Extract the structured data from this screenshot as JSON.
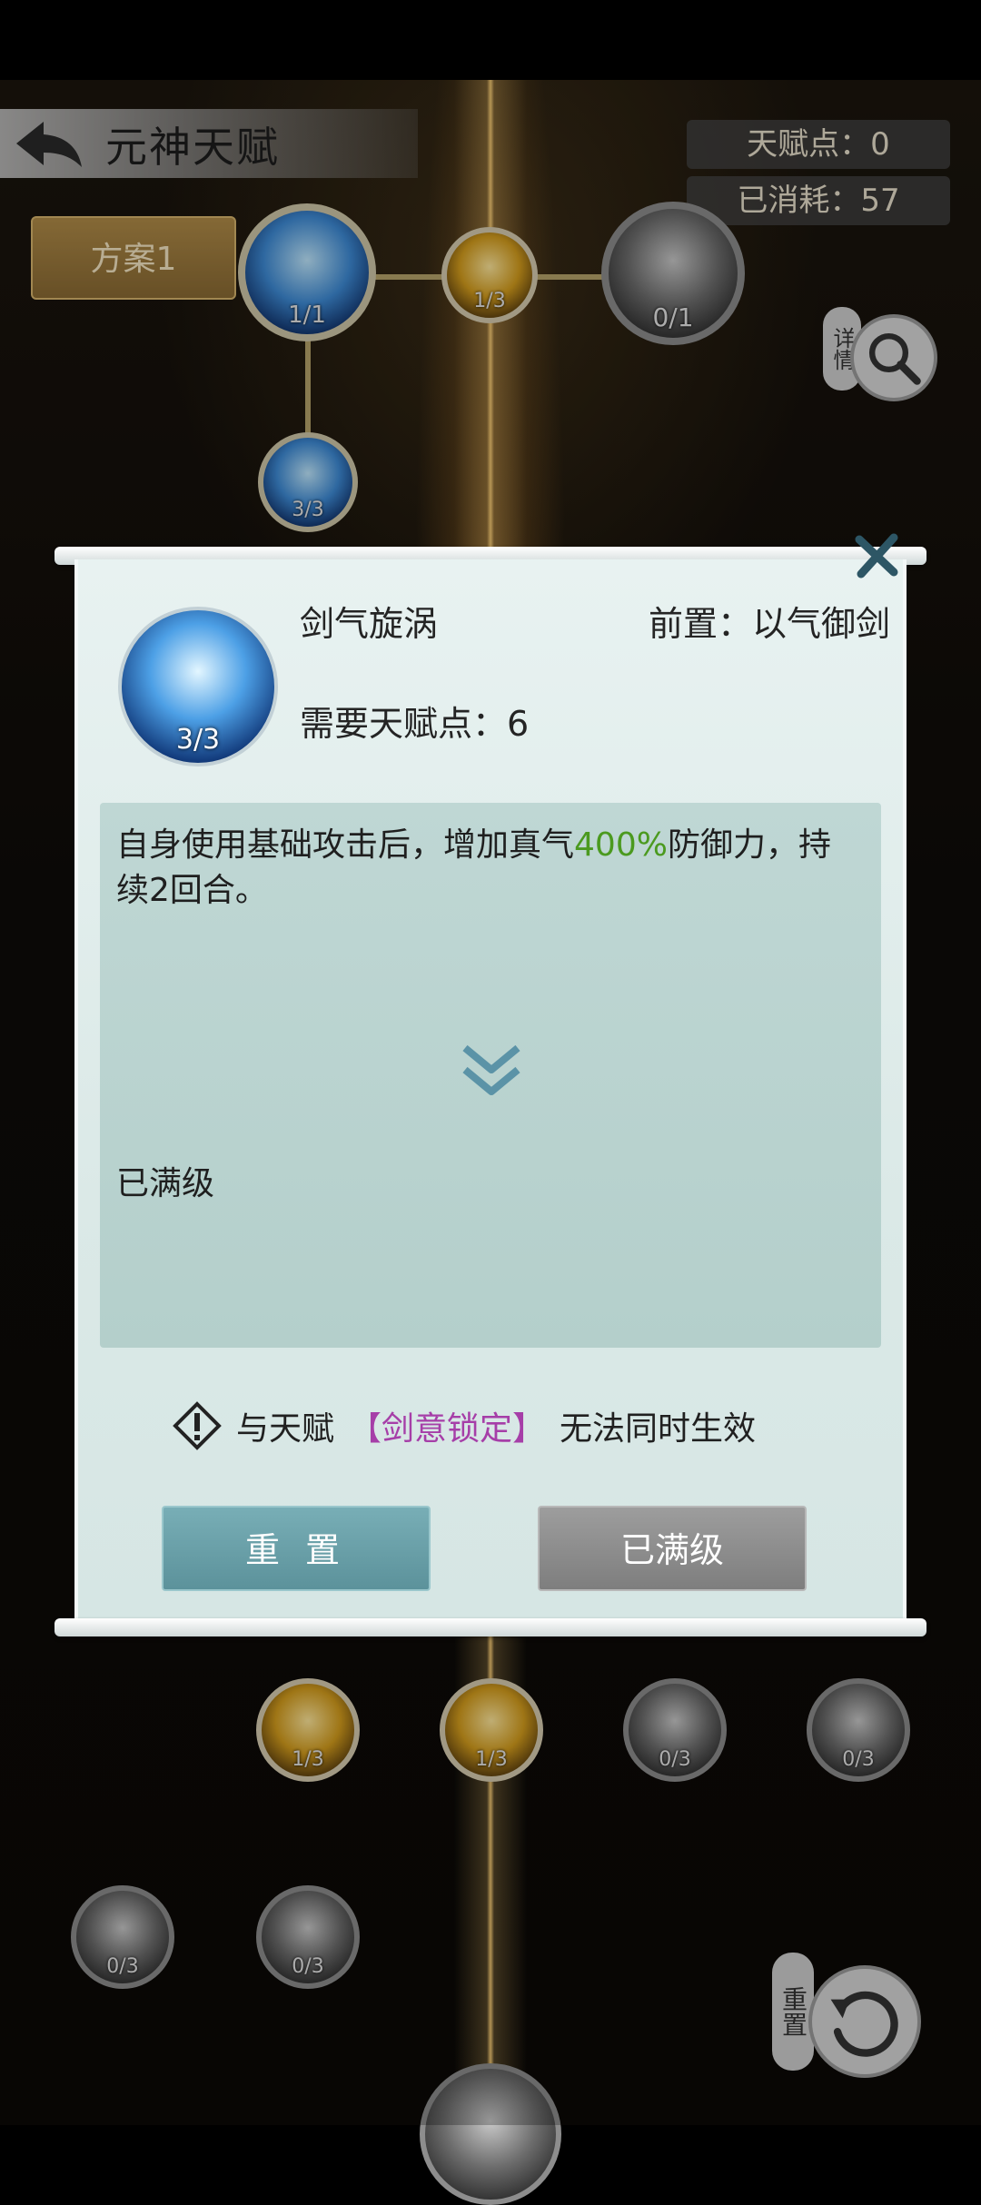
{
  "header": {
    "title": "元神天赋",
    "talent_points": "天赋点：0",
    "consumed": "已消耗：57"
  },
  "plan_button": "方案1",
  "side_buttons": {
    "detail_tag": "详情",
    "reset_tag": "重置"
  },
  "talent_tree": {
    "nodes_top": [
      "1/1",
      "1/3",
      "0/1",
      "3/3"
    ],
    "nodes_bottom": [
      "1/3",
      "1/3",
      "0/3",
      "0/3",
      "0/3",
      "0/3"
    ]
  },
  "modal": {
    "skill_level": "3/3",
    "skill_name": "剑气旋涡",
    "prerequisite": "前置：以气御剑",
    "cost": "需要天赋点：6",
    "description_before": "自身使用基础攻击后，增加真气",
    "description_highlight": "400%",
    "description_after": "防御力，持续2回合。",
    "maxed_text": "已满级",
    "warning_prefix": "与天赋",
    "warning_talent": "【剑意锁定】",
    "warning_suffix": "无法同时生效",
    "reset_button": "重 置",
    "max_button": "已满级"
  },
  "colors": {
    "highlight_green": "#4b9a1f",
    "talent_purple": "#a63ea8"
  }
}
